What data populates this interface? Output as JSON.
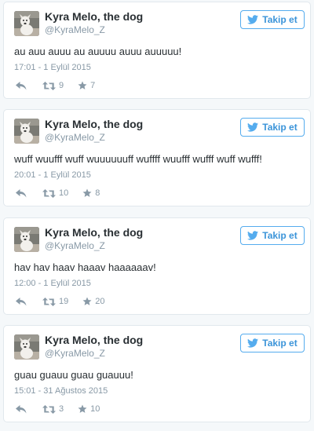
{
  "colors": {
    "accent": "#55acee",
    "follow_text": "#3b94d9",
    "muted": "#8899a6",
    "text": "#292f33",
    "border": "#e1e8ed"
  },
  "icons": {
    "follow": "twitter-bird-icon",
    "reply": "reply-icon",
    "retweet": "retweet-icon",
    "favorite": "star-icon",
    "avatar": "dog-avatar"
  },
  "tweets": [
    {
      "author": "Kyra Melo, the dog",
      "handle": "@KyraMelo_Z",
      "follow_label": "Takip et",
      "text": "au auu auuu au auuuu auuu auuuuu!",
      "time": "17:01 - 1 Eylül 2015",
      "retweets": "9",
      "favorites": "7"
    },
    {
      "author": "Kyra Melo, the dog",
      "handle": "@KyraMelo_Z",
      "follow_label": "Takip et",
      "text": "wuff wuufff wuff wuuuuuuff wuffff wuufff wufff wuff wufff!",
      "time": "20:01 - 1 Eylül 2015",
      "retweets": "10",
      "favorites": "8"
    },
    {
      "author": "Kyra Melo, the dog",
      "handle": "@KyraMelo_Z",
      "follow_label": "Takip et",
      "text": "hav hav haav haaav haaaaaav!",
      "time": "12:00 - 1 Eylül 2015",
      "retweets": "19",
      "favorites": "20"
    },
    {
      "author": "Kyra Melo, the dog",
      "handle": "@KyraMelo_Z",
      "follow_label": "Takip et",
      "text": "guau guauu guau guauuu!",
      "time": "15:01 - 31 Ağustos 2015",
      "retweets": "3",
      "favorites": "10"
    }
  ]
}
